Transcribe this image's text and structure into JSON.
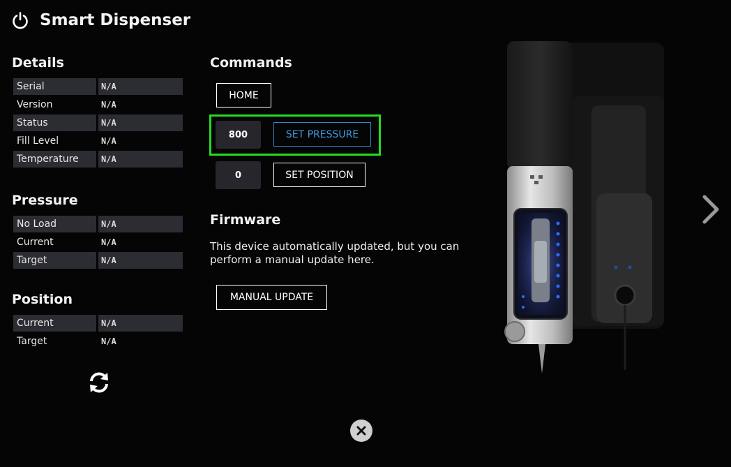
{
  "header": {
    "title": "Smart Dispenser",
    "icon": "power-icon"
  },
  "details": {
    "title": "Details",
    "rows": [
      {
        "label": "Serial",
        "value": "N/A"
      },
      {
        "label": "Version",
        "value": "N/A"
      },
      {
        "label": "Status",
        "value": "N/A"
      },
      {
        "label": "Fill Level",
        "value": "N/A"
      },
      {
        "label": "Temperature",
        "value": "N/A"
      }
    ]
  },
  "pressure": {
    "title": "Pressure",
    "rows": [
      {
        "label": "No Load",
        "value": "N/A"
      },
      {
        "label": "Current",
        "value": "N/A"
      },
      {
        "label": "Target",
        "value": "N/A"
      }
    ]
  },
  "position": {
    "title": "Position",
    "rows": [
      {
        "label": "Current",
        "value": "N/A"
      },
      {
        "label": "Target",
        "value": "N/A"
      }
    ]
  },
  "commands": {
    "title": "Commands",
    "home_label": "HOME",
    "pressure_value": "800",
    "set_pressure_label": "SET PRESSURE",
    "position_value": "0",
    "set_position_label": "SET POSITION"
  },
  "firmware": {
    "title": "Firmware",
    "description": "This device automatically updated, but you can perform a manual update here.",
    "manual_update_label": "MANUAL UPDATE"
  },
  "colors": {
    "background": "#050505",
    "row_shade": "#2c2c33",
    "accent_blue": "#3f9de0",
    "highlight_green": "#22dd22",
    "device_led": "#2f6bff"
  },
  "icons": [
    "power-icon",
    "refresh-icon",
    "chevron-right-icon",
    "close-icon"
  ]
}
